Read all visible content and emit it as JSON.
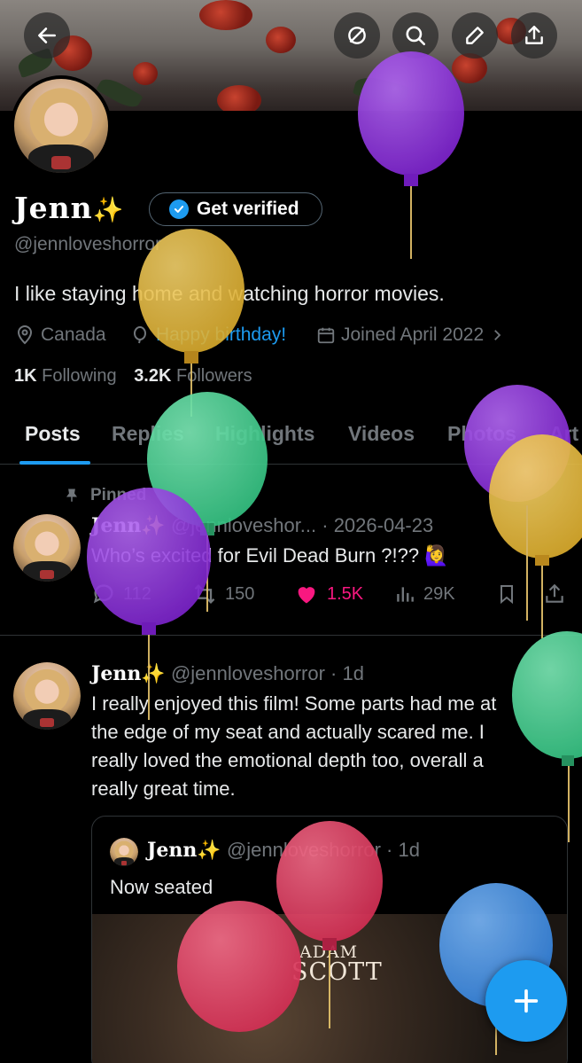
{
  "profile": {
    "name": "Jenn",
    "sparkle": "✨",
    "get_verified_label": "Get verified",
    "handle": "@jennloveshorror",
    "bio": "I like staying home and watching horror movies.",
    "location": "Canada",
    "birthday": "Happy birthday!",
    "joined": "Joined April 2022",
    "following_count": "1K",
    "following_label": "Following",
    "followers_count": "3.2K",
    "followers_label": "Followers"
  },
  "tabs": [
    "Posts",
    "Replies",
    "Highlights",
    "Videos",
    "Photos",
    "Art"
  ],
  "pinned_label": "Pinned",
  "posts": [
    {
      "name": "Jenn",
      "sparkle": "✨",
      "handle_date": "@jennloveshor... · 2026-04-23",
      "text": "Who’s excited for Evil Dead Burn ?!?? 🙋‍♀️",
      "replies": "112",
      "reposts": "150",
      "likes": "1.5K",
      "views": "29K"
    },
    {
      "name": "Jenn",
      "sparkle": "✨",
      "handle_date": "@jennloveshorror · 1d",
      "text_lines": [
        "I really enjoyed this film! Some parts had me at",
        "the edge of my seat and actually scared me. I",
        "really loved the emotional depth too, overall a",
        "really great time."
      ],
      "quote": {
        "name": "Jenn",
        "sparkle": "✨",
        "handle_date": "@jennloveshorror · 1d",
        "text": "Now seated",
        "poster_line1": "ADAM",
        "poster_line2": "SCOTT"
      }
    }
  ],
  "colors": {
    "accent": "#1d9bf0",
    "like": "#f91880",
    "muted": "#71767b",
    "balloon_purple": "#8a2bd4",
    "balloon_yellow": "#e4b93a",
    "balloon_green": "#3fcf8e",
    "balloon_red": "#e0345c",
    "balloon_blue": "#3f8fe6"
  },
  "icons": [
    "back-arrow-icon",
    "grok-icon",
    "search-icon",
    "edit-icon",
    "share-icon",
    "location-icon",
    "balloon-icon",
    "calendar-icon",
    "pin-icon",
    "reply-icon",
    "repost-icon",
    "heart-icon",
    "views-icon",
    "bookmark-icon",
    "plus-icon"
  ]
}
